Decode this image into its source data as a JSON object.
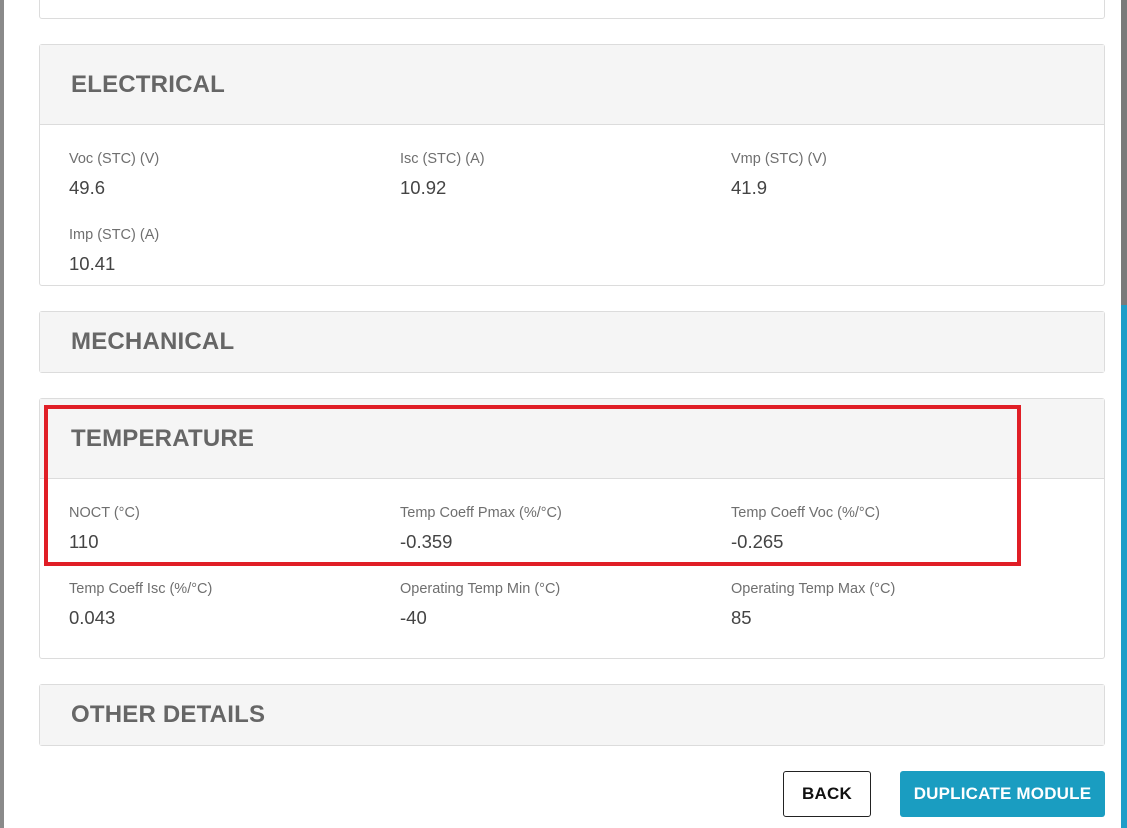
{
  "sections": {
    "electrical": {
      "title": "ELECTRICAL",
      "fields": [
        {
          "label": "Voc (STC) (V)",
          "value": "49.6"
        },
        {
          "label": "Isc (STC) (A)",
          "value": "10.92"
        },
        {
          "label": "Vmp (STC) (V)",
          "value": "41.9"
        },
        {
          "label": "Imp (STC) (A)",
          "value": "10.41"
        }
      ]
    },
    "mechanical": {
      "title": "MECHANICAL"
    },
    "temperature": {
      "title": "TEMPERATURE",
      "fields": [
        {
          "label": "NOCT (°C)",
          "value": "110"
        },
        {
          "label": "Temp Coeff Pmax (%/°C)",
          "value": "-0.359"
        },
        {
          "label": "Temp Coeff Voc (%/°C)",
          "value": "-0.265"
        },
        {
          "label": "Temp Coeff Isc (%/°C)",
          "value": "0.043"
        },
        {
          "label": "Operating Temp Min (°C)",
          "value": "-40"
        },
        {
          "label": "Operating Temp Max (°C)",
          "value": "85"
        }
      ]
    },
    "other": {
      "title": "OTHER DETAILS"
    }
  },
  "actions": {
    "back_label": "BACK",
    "duplicate_label": "DUPLICATE MODULE"
  },
  "colors": {
    "accent": "#1a9dc1",
    "highlight": "#e01e26",
    "header_bg": "#f5f5f5"
  }
}
